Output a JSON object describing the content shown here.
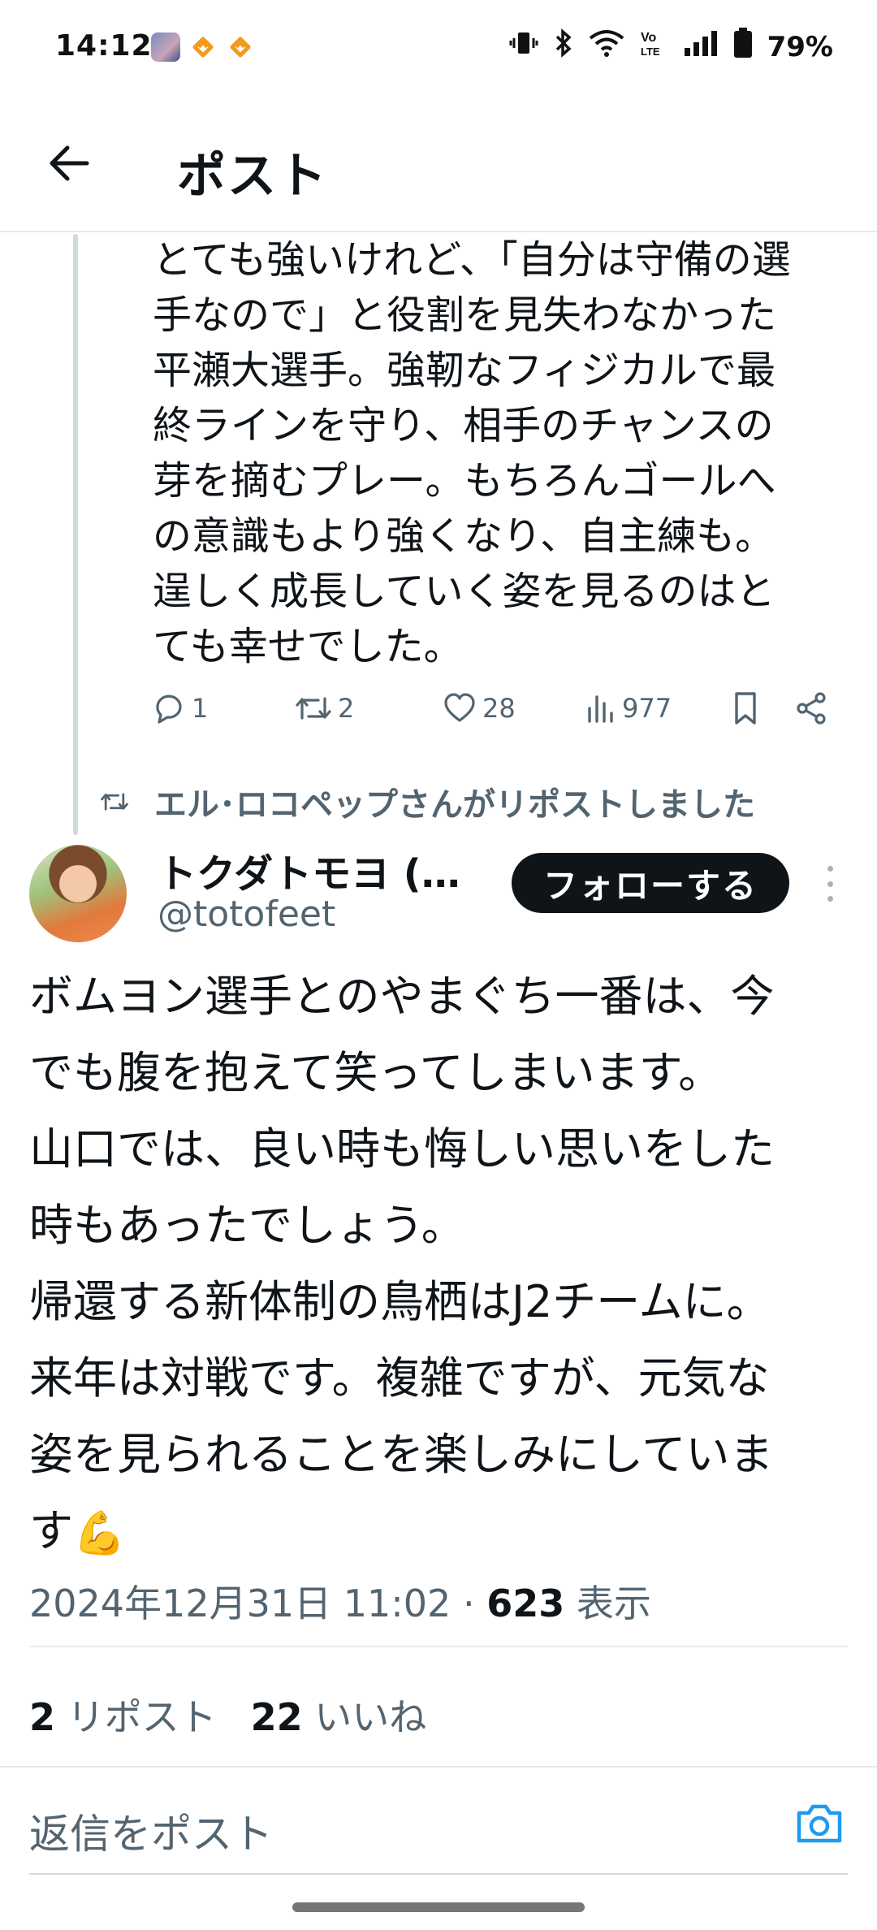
{
  "status_bar": {
    "time": "14:12",
    "battery": "79%",
    "icons": [
      "game-app-icon",
      "notification-heart-icon",
      "notification-heart-icon",
      "vibrate-icon",
      "bluetooth-icon",
      "wifi-icon",
      "volte-icon",
      "signal-icon",
      "battery-icon"
    ]
  },
  "header": {
    "title": "ポスト",
    "back_icon": "arrow-left-icon"
  },
  "parent_post": {
    "lines": [
      "とても強いけれど、「自分は守備の選",
      "手なので」と役割を見失わなかった",
      "平瀬大選手。強靭なフィジカルで最",
      "終ラインを守り、相手のチャンスの",
      "芽を摘むプレー。もちろんゴールへ",
      "の意識もより強くなり、自主練も。",
      "逞しく成長していく姿を見るのはと",
      "ても幸せでした。"
    ],
    "actions": {
      "replies": "1",
      "reposts": "2",
      "likes": "28",
      "views": "977"
    }
  },
  "repost_notice": "エル･ロコペップさんがリポストしました",
  "main_post": {
    "author_name": "トクダトモヨ (…",
    "author_handle": "@totofeet",
    "follow_label": "フォローする",
    "lines": [
      "ボムヨン選手とのやまぐち一番は、今",
      "でも腹を抱えて笑ってしまいます。",
      "山口では、良い時も悔しい思いをした",
      "時もあったでしょう。",
      "帰還する新体制の鳥栖はJ2チームに。",
      "来年は対戦です。複雑ですが、元気な",
      "姿を見られることを楽しみにしていま",
      "す"
    ],
    "emoji": "💪",
    "timestamp": "2024年12月31日 11:02 · ",
    "views_count": "623",
    "views_label": " 表示",
    "repost_count": "2",
    "repost_label": " リポスト",
    "like_count": "22",
    "like_label": " いいね"
  },
  "reply_bar": {
    "placeholder": "返信をポスト"
  },
  "colors": {
    "text_primary": "#0f1419",
    "text_secondary": "#536471",
    "accent": "#1d9bf0",
    "follow_bg": "#0f1419"
  }
}
